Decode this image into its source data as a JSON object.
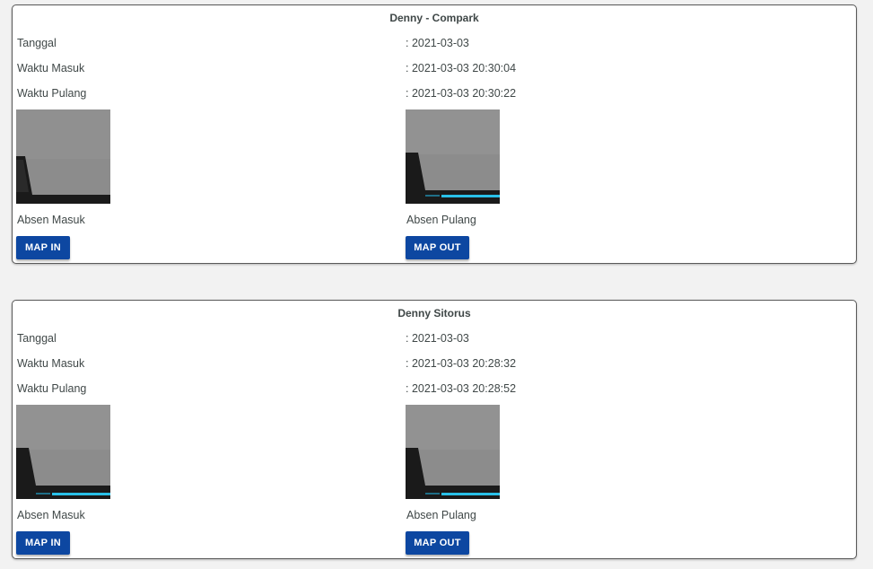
{
  "cards": [
    {
      "title": "Denny - Compark",
      "tanggal_label": "Tanggal",
      "tanggal_value": ": 2021-03-03",
      "masuk_label": "Waktu Masuk",
      "masuk_value": ": 2021-03-03 20:30:04",
      "pulang_label": "Waktu Pulang",
      "pulang_value": ": 2021-03-03 20:30:22",
      "photo_in_caption": "Absen Masuk",
      "photo_out_caption": "Absen Pulang",
      "map_in_label": "MAP IN",
      "map_out_label": "MAP OUT"
    },
    {
      "title": "Denny Sitorus",
      "tanggal_label": "Tanggal",
      "tanggal_value": ": 2021-03-03",
      "masuk_label": "Waktu Masuk",
      "masuk_value": ": 2021-03-03 20:28:32",
      "pulang_label": "Waktu Pulang",
      "pulang_value": ": 2021-03-03 20:28:52",
      "photo_in_caption": "Absen Masuk",
      "photo_out_caption": "Absen Pulang",
      "map_in_label": "MAP IN",
      "map_out_label": "MAP OUT"
    }
  ],
  "colors": {
    "button_bg": "#0d47a1",
    "button_text": "#ffffff",
    "page_bg": "#f2f2f2",
    "card_border": "#5a5a5a"
  }
}
